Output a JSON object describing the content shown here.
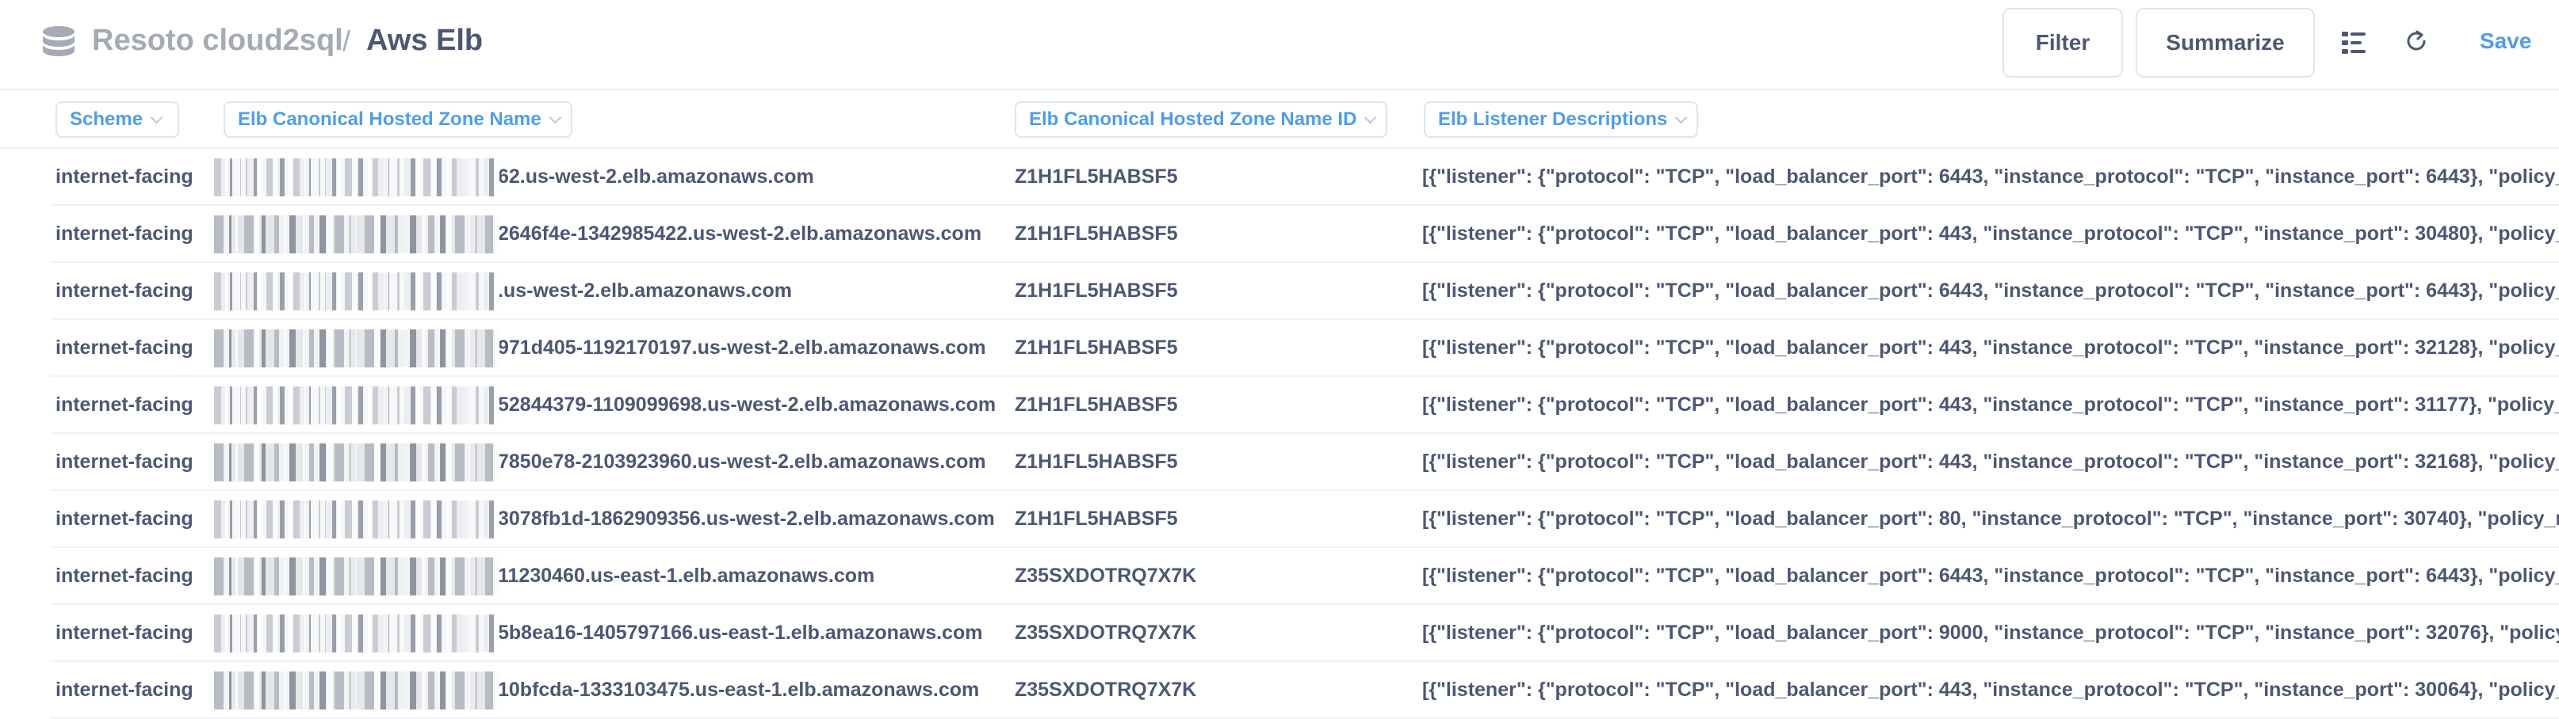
{
  "header": {
    "database": "Resoto cloud2sql",
    "separator": "/",
    "table": "Aws Elb",
    "filter_label": "Filter",
    "summarize_label": "Summarize",
    "save_label": "Save",
    "icons": [
      "database-icon",
      "notebook-icon",
      "refresh-icon"
    ]
  },
  "columns": [
    "Scheme",
    "Elb Canonical Hosted Zone Name",
    "Elb Canonical Hosted Zone Name ID",
    "Elb Listener Descriptions"
  ],
  "rows": [
    {
      "scheme": "internet-facing",
      "name": "62.us-west-2.elb.amazonaws.com",
      "zone_id": "Z1H1FL5HABSF5",
      "listeners": "[{\"listener\": {\"protocol\": \"TCP\", \"load_balancer_port\": 6443, \"instance_protocol\": \"TCP\", \"instance_port\": 6443}, \"policy_names\": []"
    },
    {
      "scheme": "internet-facing",
      "name": "2646f4e-1342985422.us-west-2.elb.amazonaws.com",
      "zone_id": "Z1H1FL5HABSF5",
      "listeners": "[{\"listener\": {\"protocol\": \"TCP\", \"load_balancer_port\": 443, \"instance_protocol\": \"TCP\", \"instance_port\": 30480}, \"policy_names\": []"
    },
    {
      "scheme": "internet-facing",
      "name": ".us-west-2.elb.amazonaws.com",
      "zone_id": "Z1H1FL5HABSF5",
      "listeners": "[{\"listener\": {\"protocol\": \"TCP\", \"load_balancer_port\": 6443, \"instance_protocol\": \"TCP\", \"instance_port\": 6443}, \"policy_names\": []"
    },
    {
      "scheme": "internet-facing",
      "name": "971d405-1192170197.us-west-2.elb.amazonaws.com",
      "zone_id": "Z1H1FL5HABSF5",
      "listeners": "[{\"listener\": {\"protocol\": \"TCP\", \"load_balancer_port\": 443, \"instance_protocol\": \"TCP\", \"instance_port\": 32128}, \"policy_names\": []"
    },
    {
      "scheme": "internet-facing",
      "name": "52844379-1109099698.us-west-2.elb.amazonaws.com",
      "zone_id": "Z1H1FL5HABSF5",
      "listeners": "[{\"listener\": {\"protocol\": \"TCP\", \"load_balancer_port\": 443, \"instance_protocol\": \"TCP\", \"instance_port\": 31177}, \"policy_names\": []"
    },
    {
      "scheme": "internet-facing",
      "name": "7850e78-2103923960.us-west-2.elb.amazonaws.com",
      "zone_id": "Z1H1FL5HABSF5",
      "listeners": "[{\"listener\": {\"protocol\": \"TCP\", \"load_balancer_port\": 443, \"instance_protocol\": \"TCP\", \"instance_port\": 32168}, \"policy_names\": []"
    },
    {
      "scheme": "internet-facing",
      "name": "3078fb1d-1862909356.us-west-2.elb.amazonaws.com",
      "zone_id": "Z1H1FL5HABSF5",
      "listeners": "[{\"listener\": {\"protocol\": \"TCP\", \"load_balancer_port\": 80, \"instance_protocol\": \"TCP\", \"instance_port\": 30740}, \"policy_names\": []}]"
    },
    {
      "scheme": "internet-facing",
      "name": "11230460.us-east-1.elb.amazonaws.com",
      "zone_id": "Z35SXDOTRQ7X7K",
      "listeners": "[{\"listener\": {\"protocol\": \"TCP\", \"load_balancer_port\": 6443, \"instance_protocol\": \"TCP\", \"instance_port\": 6443}, \"policy_names\": []"
    },
    {
      "scheme": "internet-facing",
      "name": "5b8ea16-1405797166.us-east-1.elb.amazonaws.com",
      "zone_id": "Z35SXDOTRQ7X7K",
      "listeners": "[{\"listener\": {\"protocol\": \"TCP\", \"load_balancer_port\": 9000, \"instance_protocol\": \"TCP\", \"instance_port\": 32076}, \"policy_names\": ["
    },
    {
      "scheme": "internet-facing",
      "name": "10bfcda-1333103475.us-east-1.elb.amazonaws.com",
      "zone_id": "Z35SXDOTRQ7X7K",
      "listeners": "[{\"listener\": {\"protocol\": \"TCP\", \"load_balancer_port\": 443, \"instance_protocol\": \"TCP\", \"instance_port\": 30064}, \"policy_names\": []"
    }
  ]
}
